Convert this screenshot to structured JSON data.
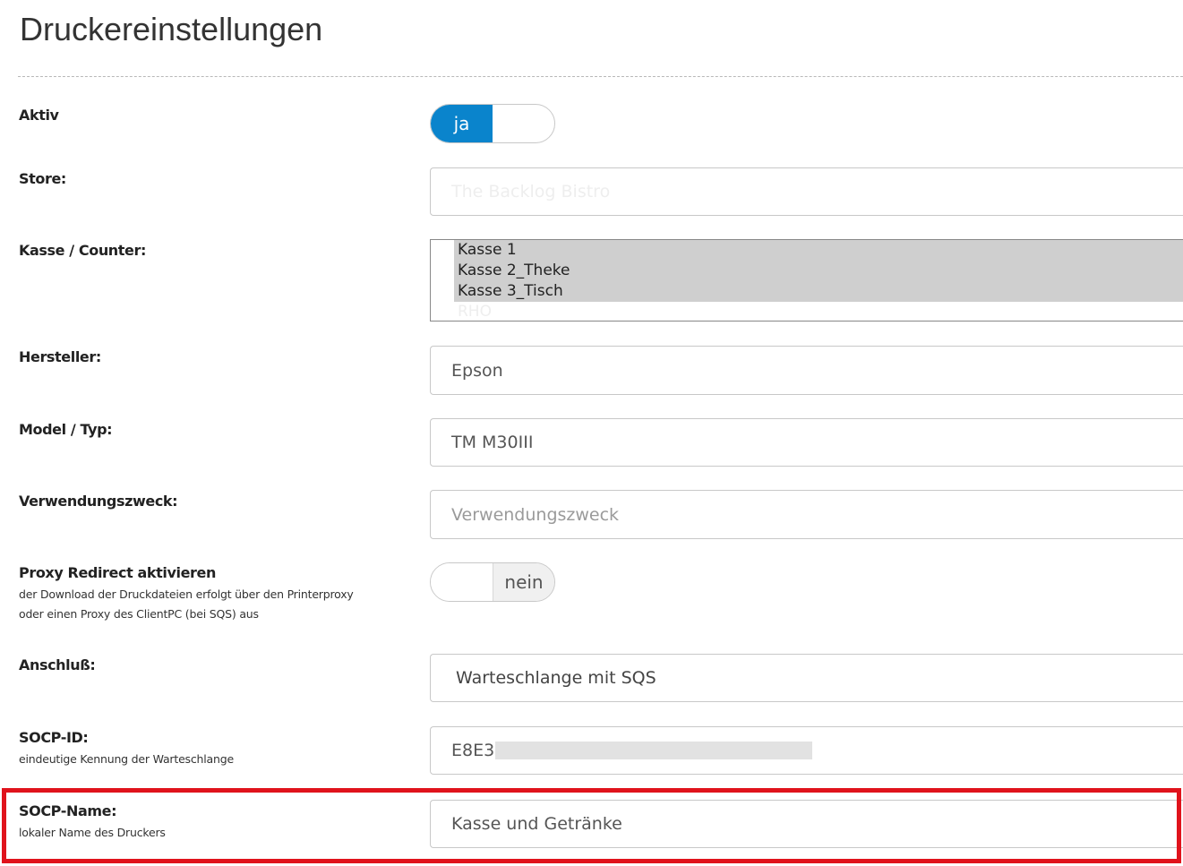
{
  "page_title": "Druckereinstellungen",
  "fields": {
    "aktiv": {
      "label": "Aktiv",
      "toggle_on_label": "ja",
      "state": "on"
    },
    "store": {
      "label": "Store:",
      "value": "The Backlog Bistro"
    },
    "kasse": {
      "label": "Kasse / Counter:",
      "options": [
        "Kasse 1",
        "Kasse 2_Theke",
        "Kasse 3_Tisch",
        "RHO"
      ],
      "selected": [
        "Kasse 1",
        "Kasse 2_Theke",
        "Kasse 3_Tisch"
      ]
    },
    "hersteller": {
      "label": "Hersteller:",
      "value": "Epson"
    },
    "model": {
      "label": "Model / Typ:",
      "value": "TM M30III"
    },
    "verwendungszweck": {
      "label": "Verwendungszweck:",
      "placeholder": "Verwendungszweck"
    },
    "proxy": {
      "label": "Proxy Redirect aktivieren",
      "hint_line1": "der Download der Druckdateien erfolgt über den Printerproxy",
      "hint_line2": "oder einen Proxy des ClientPC (bei SQS) aus",
      "toggle_off_label": "nein",
      "state": "off"
    },
    "anschluss": {
      "label": "Anschluß:",
      "value": "Warteschlange mit SQS"
    },
    "socp_id": {
      "label": "SOCP-ID:",
      "hint": "eindeutige Kennung der Warteschlange",
      "value": "E8E3"
    },
    "socp_name": {
      "label": "SOCP-Name:",
      "hint": "lokaler Name des Druckers",
      "value": "Kasse und Getränke"
    }
  },
  "colors": {
    "toggle_on": "#0a84cc",
    "highlight_border": "#e0131c"
  }
}
